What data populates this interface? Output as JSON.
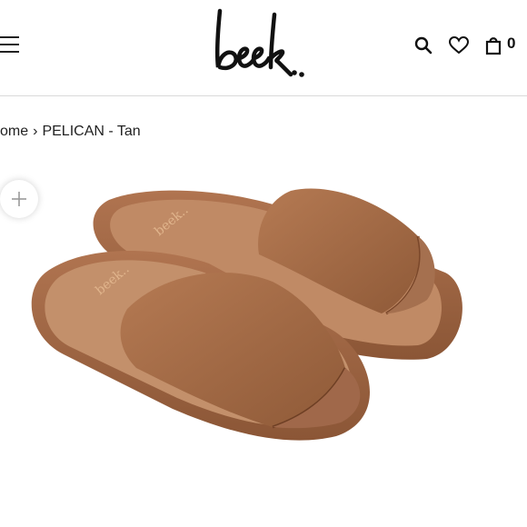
{
  "brand": {
    "logo_text": "beek..",
    "accent": "#222222"
  },
  "header": {
    "menu_icon": "hamburger-menu-icon",
    "actions": [
      {
        "name": "search",
        "icon": "search-icon"
      },
      {
        "name": "wishlist",
        "icon": "heart-icon"
      },
      {
        "name": "cart",
        "icon": "bag-icon"
      }
    ],
    "cart_count": "0"
  },
  "breadcrumb": {
    "home": "ome",
    "separator": "›",
    "current": "PELICAN - Tan"
  },
  "product": {
    "image_description_icon": "zoom-plus-icon",
    "color_swatch": "#a76f4a"
  }
}
